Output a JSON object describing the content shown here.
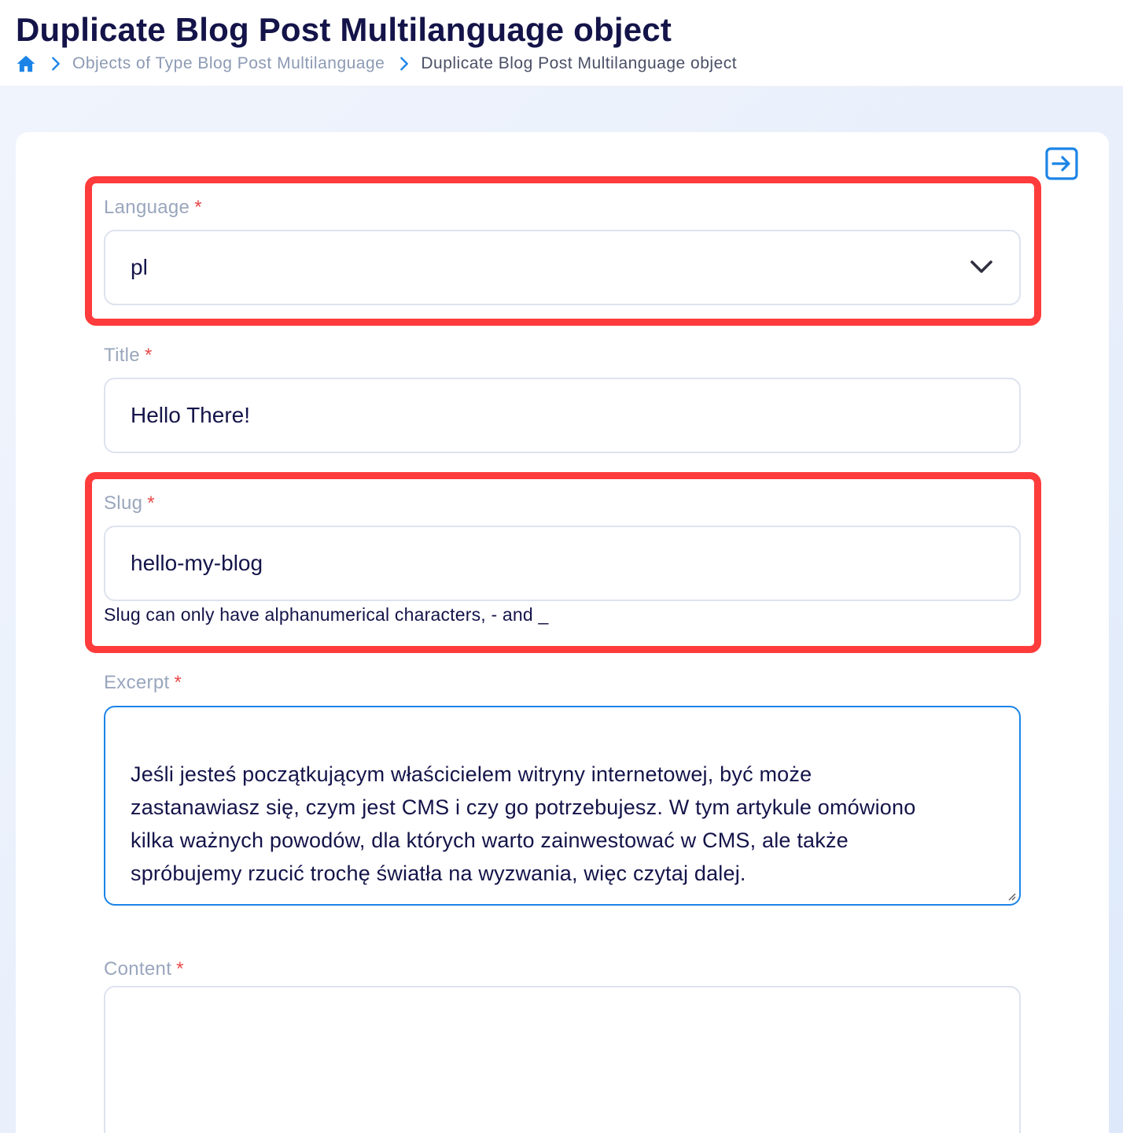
{
  "header": {
    "title": "Duplicate Blog Post Multilanguage object",
    "breadcrumb": {
      "home_icon": "home-icon",
      "items": [
        {
          "label": "Objects of Type Blog Post Multilanguage"
        },
        {
          "label": "Duplicate Blog Post Multilanguage object"
        }
      ]
    }
  },
  "colors": {
    "accent": "#1b84e7",
    "title": "#14144a",
    "highlight": "#ff3b3b",
    "required": "#e84a4a"
  },
  "form": {
    "language": {
      "label": "Language",
      "required_mark": "*",
      "value": "pl"
    },
    "title": {
      "label": "Title",
      "required_mark": "*",
      "value": "Hello There!"
    },
    "slug": {
      "label": "Slug",
      "required_mark": "*",
      "value": "hello-my-blog",
      "helper": "Slug can only have alphanumerical characters, - and _"
    },
    "excerpt": {
      "label": "Excerpt",
      "required_mark": "*",
      "value": "Jeśli jesteś początkującym właścicielem witryny internetowej, być może\nzastanawiasz się, czym jest CMS i czy go potrzebujesz. W tym artykule omówiono\nkilka ważnych powodów, dla których warto zainwestować w CMS, ale także\nspróbujemy rzucić trochę światła na wyzwania, więc czytaj dalej."
    },
    "content": {
      "label": "Content",
      "required_mark": "*",
      "value": ""
    }
  },
  "icons": {
    "collapse": "arrow-right-box-icon",
    "select": "chevron-down-icon",
    "separator": "chevron-right-icon"
  }
}
